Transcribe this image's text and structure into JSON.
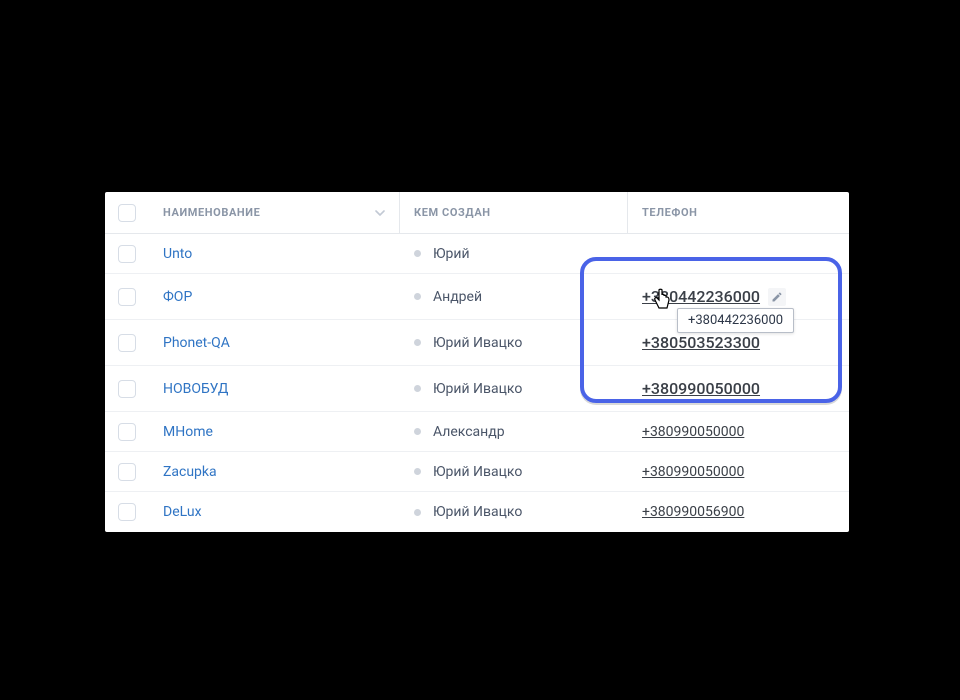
{
  "columns": {
    "name": "НАИМЕНОВАНИЕ",
    "creator": "КЕМ СОЗДАН",
    "phone": "ТЕЛЕФОН"
  },
  "rows": [
    {
      "name": "Unto",
      "creator": "Юрий",
      "phone": ""
    },
    {
      "name": "ФОР",
      "creator": "Андрей",
      "phone": "+380442236000"
    },
    {
      "name": "Phonet-QA",
      "creator": "Юрий Ивацко",
      "phone": "+380503523300"
    },
    {
      "name": "НОВОБУД",
      "creator": "Юрий Ивацко",
      "phone": "+380990050000"
    },
    {
      "name": "MHome",
      "creator": "Александр",
      "phone": "+380990050000"
    },
    {
      "name": "Zacupka",
      "creator": "Юрий Ивацко",
      "phone": "+380990050000"
    },
    {
      "name": "DeLux",
      "creator": "Юрий Ивацко",
      "phone": "+380990056900"
    }
  ],
  "tooltip": "+380442236000"
}
